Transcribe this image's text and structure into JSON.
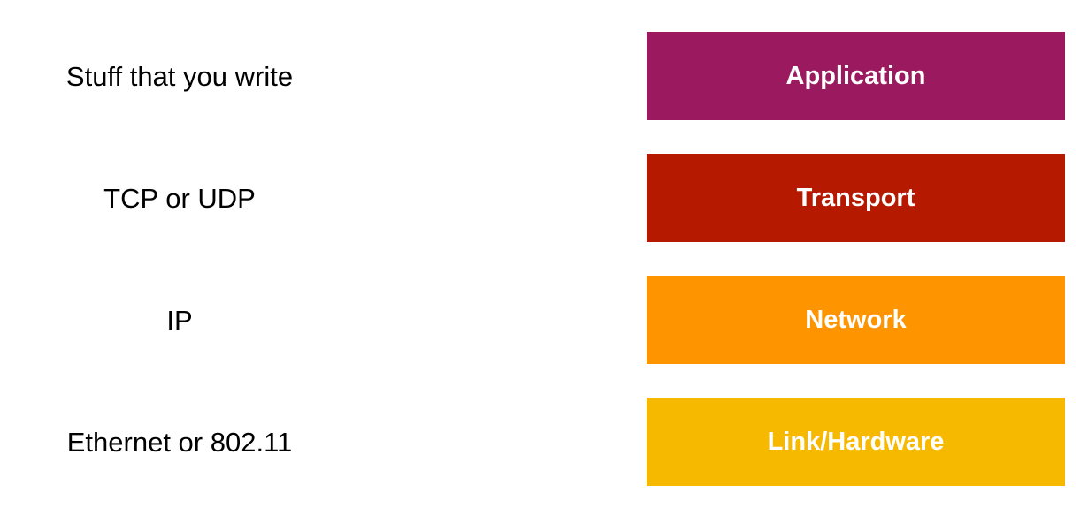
{
  "rows": [
    {
      "description": "Stuff that you write",
      "layer": "Application",
      "color": "#9b1a5f"
    },
    {
      "description": "TCP or UDP",
      "layer": "Transport",
      "color": "#b51a00"
    },
    {
      "description": "IP",
      "layer": "Network",
      "color": "#fe9400"
    },
    {
      "description": "Ethernet or 802.11",
      "layer": "Link/Hardware",
      "color": "#f6b900"
    }
  ]
}
